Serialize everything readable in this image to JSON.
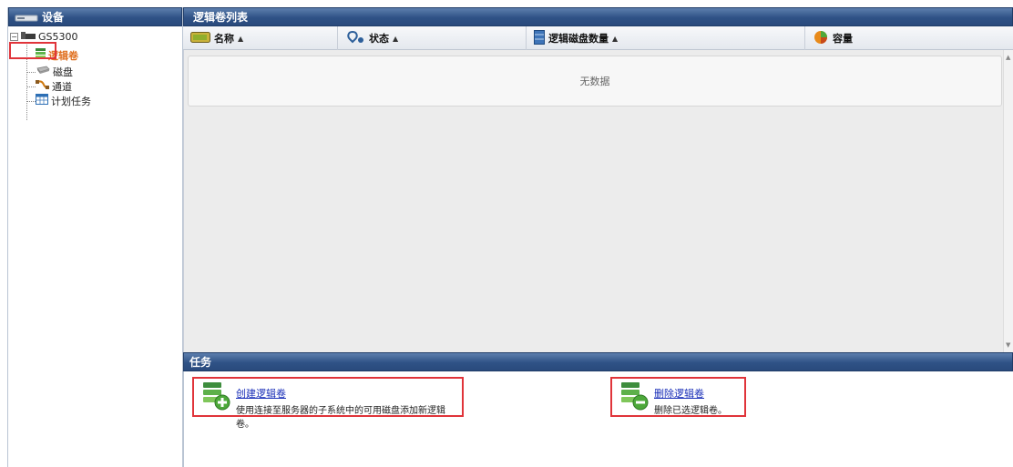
{
  "left_panel": {
    "title": "设备",
    "tree": {
      "root": "GS5300",
      "items": [
        {
          "label": "逻辑卷",
          "icon": "logical-volume-icon",
          "selected": true
        },
        {
          "label": "磁盘",
          "icon": "disk-icon",
          "selected": false
        },
        {
          "label": "通道",
          "icon": "channel-icon",
          "selected": false
        },
        {
          "label": "计划任务",
          "icon": "calendar-icon",
          "selected": false
        }
      ]
    }
  },
  "list_panel": {
    "title": "逻辑卷列表",
    "columns": [
      {
        "label": "名称",
        "icon": "name-icon",
        "sort": "▲"
      },
      {
        "label": "状态",
        "icon": "status-icon",
        "sort": "▲"
      },
      {
        "label": "逻辑磁盘数量",
        "icon": "disk-count-icon",
        "sort": "▲"
      },
      {
        "label": "容量",
        "icon": "capacity-pie-icon",
        "sort": ""
      }
    ],
    "empty_text": "无数据"
  },
  "task_panel": {
    "title": "任务",
    "tasks": [
      {
        "link": "创建逻辑卷",
        "desc": "使用连接至服务器的子系统中的可用磁盘添加新逻辑卷。",
        "icon": "add-volume-icon"
      },
      {
        "link": "删除逻辑卷",
        "desc": "删除已选逻辑卷。",
        "icon": "remove-volume-icon"
      }
    ]
  },
  "colors": {
    "title_bar": "#2f5286",
    "highlight": "#e0343a",
    "link": "#1a2fb8",
    "selected_text": "#e07020"
  }
}
